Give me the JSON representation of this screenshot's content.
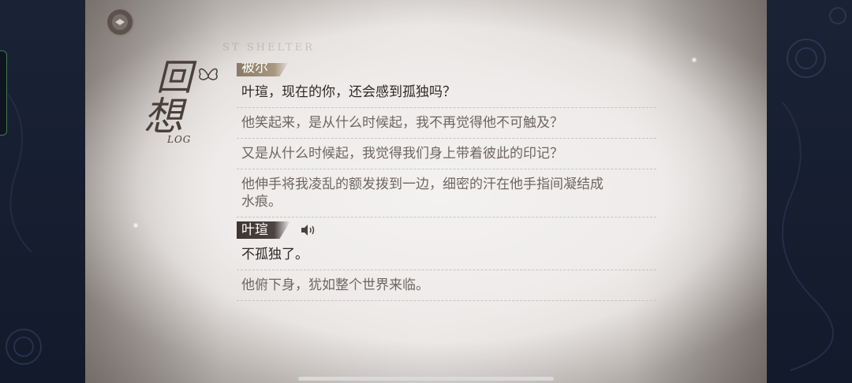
{
  "title": {
    "main_char_1": "回",
    "main_char_2": "想",
    "sub": "LOG"
  },
  "watermark": "ST SHELTER",
  "entries": [
    {
      "speaker": "被尔",
      "lines": [
        "叶瑄，现在的你，还会感到孤独吗？"
      ],
      "style": "primary"
    },
    {
      "lines": [
        "他笑起来，是从什么时候起，我不再觉得他不可触及？"
      ],
      "style": "narration"
    },
    {
      "lines": [
        "又是从什么时候起，我觉得我们身上带着彼此的印记？"
      ],
      "style": "narration"
    },
    {
      "lines": [
        "他伸手将我凌乱的额发拨到一边，细密的汗在他手指间凝结成",
        "水痕。"
      ],
      "style": "narration"
    },
    {
      "speaker": "叶瑄",
      "voice_icon": "speaker-icon",
      "lines": [
        "不孤独了。"
      ],
      "style": "primary"
    },
    {
      "lines": [
        "他俯下身，犹如整个世界来临。"
      ],
      "style": "narration"
    }
  ],
  "colors": {
    "speaker_tag_dark": "#4d4340",
    "speaker_tag_gold": "#a89780",
    "primary_text": "#2e2825",
    "narration_text": "#6e6662"
  }
}
